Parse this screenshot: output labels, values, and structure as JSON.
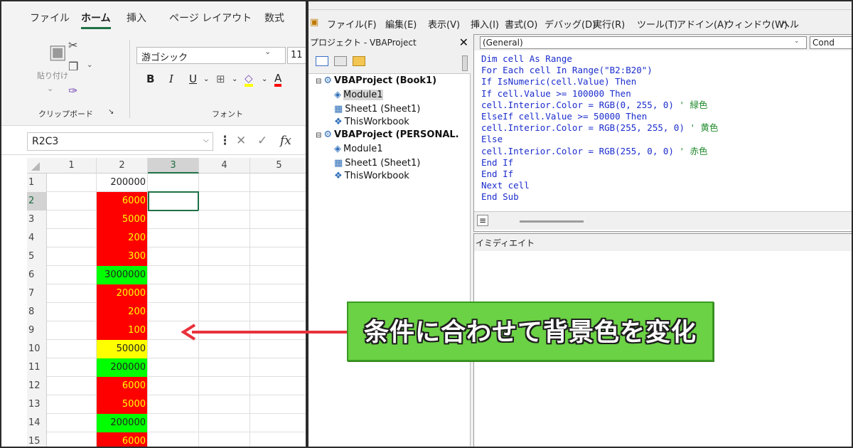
{
  "excel": {
    "tabs": [
      "ファイル",
      "ホーム",
      "挿入",
      "ページ レイアウト",
      "数式"
    ],
    "active_tab": "ホーム",
    "ribbon": {
      "paste_label": "貼り付け",
      "clipboard_group": "クリップボード",
      "font_group": "フォント",
      "font_name": "游ゴシック",
      "font_size": "11",
      "bold": "B",
      "italic": "I",
      "underline": "U"
    },
    "name_box": "R2C3",
    "fx": "fx",
    "columns": [
      "1",
      "2",
      "3",
      "4",
      "5"
    ],
    "selected_column": "3",
    "rows": [
      {
        "num": "1",
        "value": "200000",
        "fill": ""
      },
      {
        "num": "2",
        "value": "6000",
        "fill": "#ff0000"
      },
      {
        "num": "3",
        "value": "5000",
        "fill": "#ff0000"
      },
      {
        "num": "4",
        "value": "200",
        "fill": "#ff0000"
      },
      {
        "num": "5",
        "value": "300",
        "fill": "#ff0000"
      },
      {
        "num": "6",
        "value": "3000000",
        "fill": "#00ff00"
      },
      {
        "num": "7",
        "value": "20000",
        "fill": "#ff0000"
      },
      {
        "num": "8",
        "value": "200",
        "fill": "#ff0000"
      },
      {
        "num": "9",
        "value": "100",
        "fill": "#ff0000"
      },
      {
        "num": "10",
        "value": "50000",
        "fill": "#ffff00"
      },
      {
        "num": "11",
        "value": "200000",
        "fill": "#00ff00"
      },
      {
        "num": "12",
        "value": "6000",
        "fill": "#ff0000"
      },
      {
        "num": "13",
        "value": "5000",
        "fill": "#ff0000"
      },
      {
        "num": "14",
        "value": "200000",
        "fill": "#00ff00"
      },
      {
        "num": "15",
        "value": "6000",
        "fill": "#ff0000"
      }
    ],
    "selected_row": "2"
  },
  "vbe": {
    "menu": [
      "ファイル(F)",
      "編集(E)",
      "表示(V)",
      "挿入(I)",
      "書式(O)",
      "デバッグ(D)",
      "実行(R)",
      "ツール(T)",
      "アドイン(A)",
      "ウィンドウ(W)",
      "ヘル"
    ],
    "project_title": "プロジェクト - VBAProject",
    "tree": [
      {
        "label": "VBAProject (Book1)",
        "icon": "project-icon"
      },
      {
        "label": "Module1",
        "icon": "module-icon"
      },
      {
        "label": "Sheet1 (Sheet1)",
        "icon": "sheet-icon"
      },
      {
        "label": "ThisWorkbook",
        "icon": "workbook-icon"
      },
      {
        "label": "VBAProject (PERSONAL.",
        "icon": "project-icon"
      },
      {
        "label": "Module1",
        "icon": "module-icon"
      },
      {
        "label": "Sheet1 (Sheet1)",
        "icon": "sheet-icon"
      },
      {
        "label": "ThisWorkbook",
        "icon": "workbook-icon"
      }
    ],
    "object_box": "(General)",
    "proc_box": "Cond",
    "code_lines": [
      {
        "text": "Dim cell As Range",
        "comment": ""
      },
      {
        "text": "For Each cell In Range(\"B2:B20\")",
        "comment": ""
      },
      {
        "text": "If IsNumeric(cell.Value) Then",
        "comment": ""
      },
      {
        "text": "If cell.Value >= 100000 Then",
        "comment": ""
      },
      {
        "text": "cell.Interior.Color = RGB(0, 255, 0) ",
        "comment": "' 緑色"
      },
      {
        "text": "ElseIf cell.Value >= 50000 Then",
        "comment": ""
      },
      {
        "text": "cell.Interior.Color = RGB(255, 255, 0) ",
        "comment": "' 黄色"
      },
      {
        "text": "Else",
        "comment": ""
      },
      {
        "text": "cell.Interior.Color = RGB(255, 0, 0) ",
        "comment": "' 赤色"
      },
      {
        "text": "End If",
        "comment": ""
      },
      {
        "text": "End If",
        "comment": ""
      },
      {
        "text": "Next cell",
        "comment": ""
      },
      {
        "text": "End Sub",
        "comment": ""
      }
    ],
    "immediate_title": "イミディエイト"
  },
  "callout": {
    "text": "条件に合わせて背景色を変化",
    "fill": "#6ad244",
    "arrow_color": "#e8323c"
  }
}
